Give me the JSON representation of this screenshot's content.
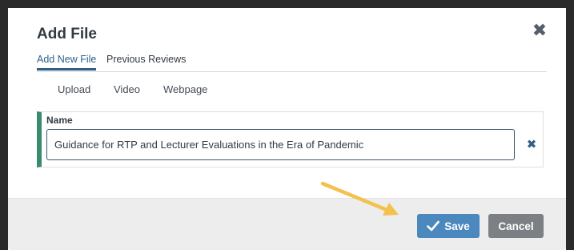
{
  "dialog": {
    "title": "Add File",
    "close_icon": "close-icon"
  },
  "tabs": [
    {
      "label": "Add New File",
      "active": true
    },
    {
      "label": "Previous Reviews",
      "active": false
    }
  ],
  "subtabs": [
    {
      "label": "Upload"
    },
    {
      "label": "Video"
    },
    {
      "label": "Webpage"
    }
  ],
  "name_field": {
    "label": "Name",
    "value": "Guidance for RTP and Lecturer Evaluations in the Era of Pandemic",
    "clear_icon": "clear-icon"
  },
  "footer": {
    "save_label": "Save",
    "cancel_label": "Cancel"
  },
  "colors": {
    "accent": "#2f5f88",
    "field_bar": "#3a8a72",
    "save_button": "#4a88bd",
    "cancel_button": "#7c8085",
    "annotation_arrow": "#f2c14e"
  }
}
